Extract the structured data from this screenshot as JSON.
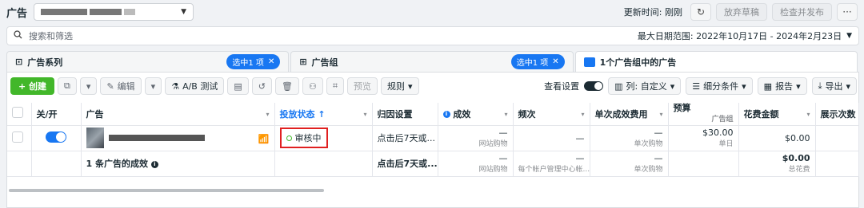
{
  "topbar": {
    "title": "广告",
    "update_label": "更新时间: 刚刚",
    "discard_label": "放弃草稿",
    "publish_label": "检查并发布",
    "more_label": "···"
  },
  "search": {
    "placeholder": "搜索和筛选",
    "date_range": "最大日期范围: 2022年10月17日 - 2024年2月23日"
  },
  "tabs": [
    {
      "label": "广告系列",
      "chip": "选中1 项"
    },
    {
      "label": "广告组",
      "chip": "选中1 项"
    },
    {
      "label": "1个广告组中的广告"
    }
  ],
  "toolbar": {
    "create": "+ 创建",
    "edit": "编辑",
    "ab_test": "A/B 测试",
    "preview": "预览",
    "rules": "规则",
    "view_settings": "查看设置",
    "columns": "列: 自定义",
    "breakdown": "细分条件",
    "reports": "报告",
    "export": "导出"
  },
  "table": {
    "headers": [
      "关/开",
      "广告",
      "投放状态 ↑",
      "归因设置",
      "成效",
      "频次",
      "单次成效费用",
      "预算",
      "花费金额",
      "展示次数"
    ],
    "budget_sub": "广告组",
    "row": {
      "status": "审核中",
      "attribution": "点击后7天或...",
      "result": "—",
      "result_sub": "网站购物",
      "frequency": "—",
      "cpr": "—",
      "cpr_sub": "单次购物",
      "budget": "$30.00",
      "budget_sub": "单日",
      "spend": "$0.00"
    },
    "summary": {
      "label": "1 条广告的成效",
      "attribution": "点击后7天或...",
      "result": "—",
      "result_sub": "网站购物",
      "frequency": "—",
      "frequency_sub": "每个帐户管理中心帐...",
      "cpr": "—",
      "cpr_sub": "单次购物",
      "spend": "$0.00",
      "spend_sub": "总花费"
    }
  }
}
